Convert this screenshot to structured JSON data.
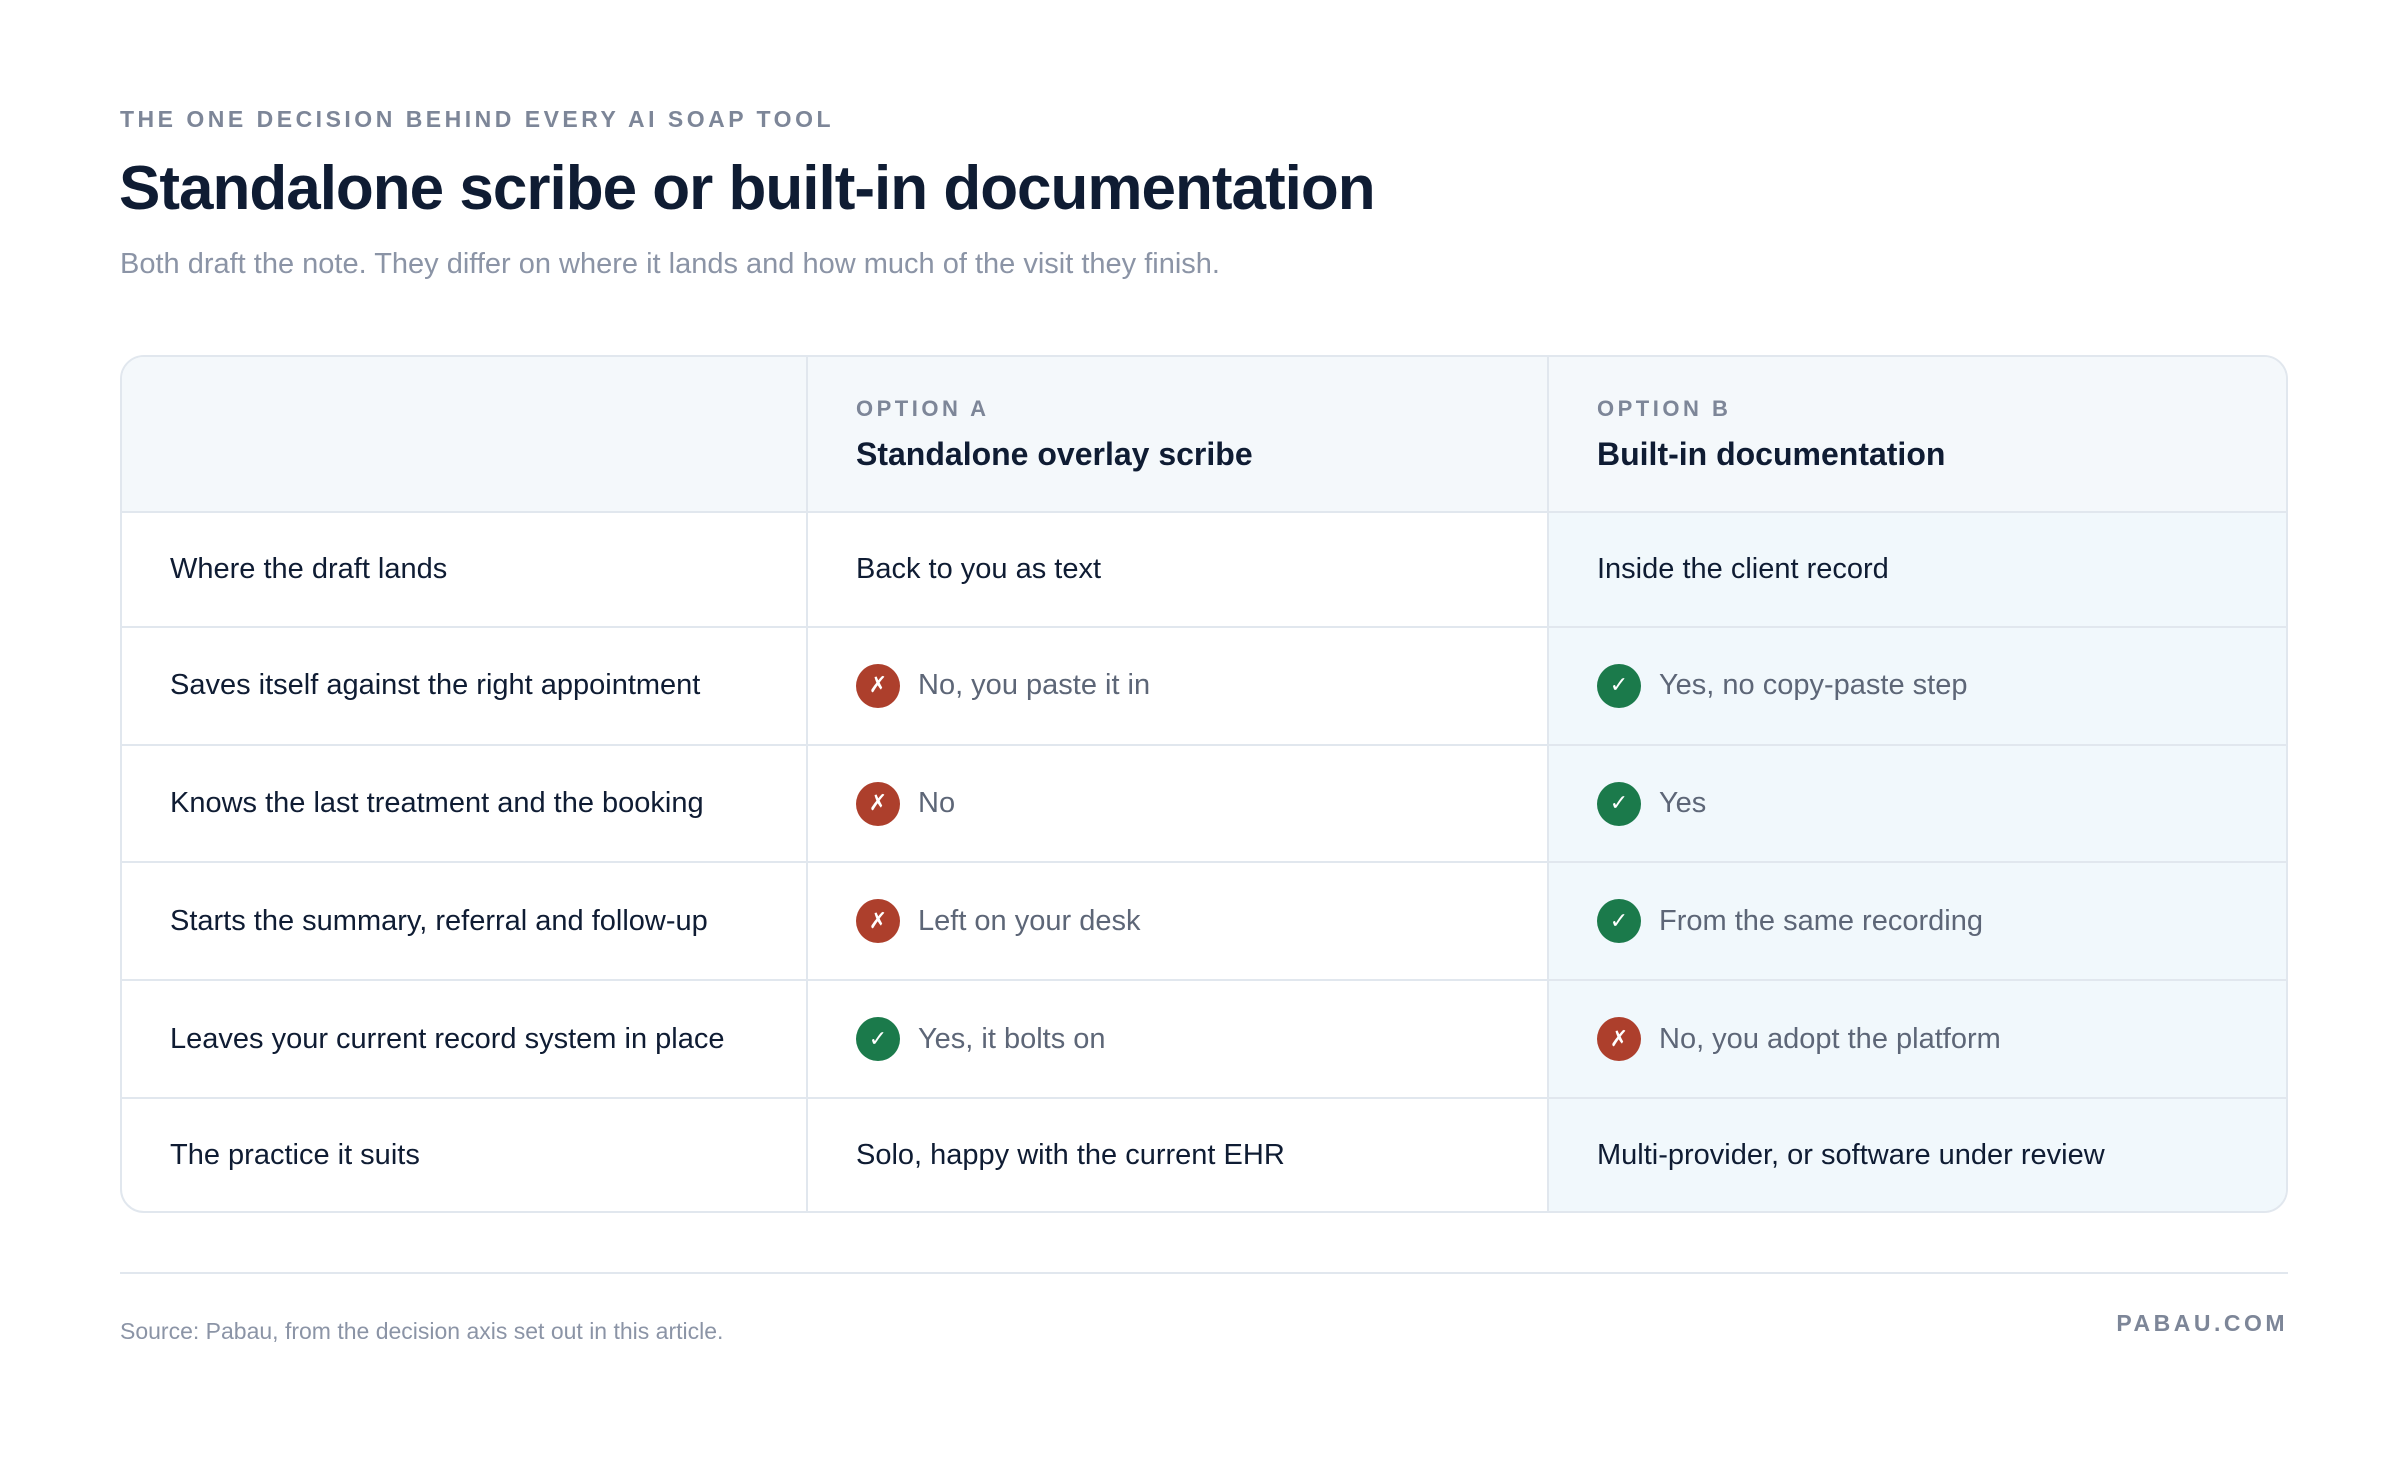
{
  "header": {
    "eyebrow": "THE ONE DECISION BEHIND EVERY AI SOAP TOOL",
    "title": "Standalone scribe or built-in documentation",
    "subtitle": "Both draft the note. They differ on where it lands and how much of the visit they finish."
  },
  "table": {
    "option_a": {
      "label": "OPTION A",
      "name": "Standalone overlay scribe"
    },
    "option_b": {
      "label": "OPTION B",
      "name": "Built-in documentation"
    },
    "rows": [
      {
        "label": "Where the draft lands",
        "a": {
          "text": "Back to you as text"
        },
        "b": {
          "text": "Inside the client record"
        }
      },
      {
        "label": "Saves itself against the right appointment",
        "a": {
          "icon": "cross-icon",
          "mark": "✗",
          "text": "No, you paste it in"
        },
        "b": {
          "icon": "check-icon",
          "mark": "✓",
          "text": "Yes, no copy-paste step"
        }
      },
      {
        "label": "Knows the last treatment and the booking",
        "a": {
          "icon": "cross-icon",
          "mark": "✗",
          "text": "No"
        },
        "b": {
          "icon": "check-icon",
          "mark": "✓",
          "text": "Yes"
        }
      },
      {
        "label": "Starts the summary, referral and follow-up",
        "a": {
          "icon": "cross-icon",
          "mark": "✗",
          "text": "Left on your desk"
        },
        "b": {
          "icon": "check-icon",
          "mark": "✓",
          "text": "From the same recording"
        }
      },
      {
        "label": "Leaves your current record system in place",
        "a": {
          "icon": "check-icon",
          "mark": "✓",
          "text": "Yes, it bolts on"
        },
        "b": {
          "icon": "cross-icon",
          "mark": "✗",
          "text": "No, you adopt the platform"
        }
      },
      {
        "label": "The practice it suits",
        "a": {
          "text": "Solo, happy with the current EHR"
        },
        "b": {
          "text": "Multi-provider, or software under review"
        }
      }
    ]
  },
  "footer": {
    "source": "Source: Pabau, from the decision axis set out in this article.",
    "brand": "PABAU.COM"
  },
  "colors": {
    "check": "#1b7a4b",
    "cross": "#ad3f2c",
    "heading": "#0f1c33",
    "muted": "#7d8698",
    "option_b_tint": "#f1f8fc"
  }
}
